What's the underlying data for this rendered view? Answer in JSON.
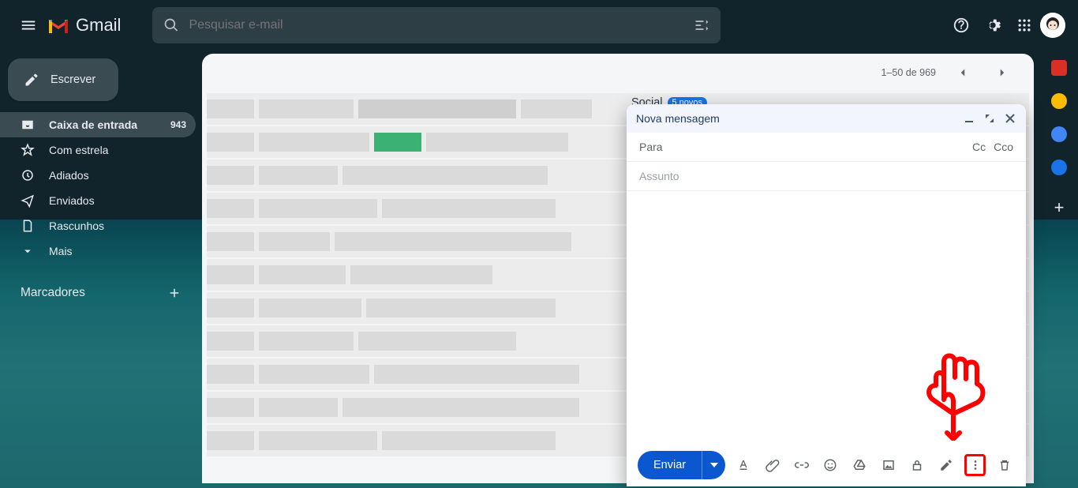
{
  "app": {
    "name": "Gmail"
  },
  "header": {
    "search_placeholder": "Pesquisar e-mail"
  },
  "compose_button": {
    "label": "Escrever"
  },
  "sidebar": {
    "items": [
      {
        "icon": "inbox",
        "label": "Caixa de entrada",
        "count": "943",
        "active": true
      },
      {
        "icon": "star",
        "label": "Com estrela"
      },
      {
        "icon": "clock",
        "label": "Adiados"
      },
      {
        "icon": "send",
        "label": "Enviados"
      },
      {
        "icon": "draft",
        "label": "Rascunhos"
      },
      {
        "icon": "more",
        "label": "Mais"
      }
    ],
    "labels_header": "Marcadores"
  },
  "list": {
    "range_text": "1–50 de 969",
    "social_tab": {
      "label": "Social",
      "badge": "5 novos"
    }
  },
  "compose_window": {
    "title": "Nova mensagem",
    "to_label": "Para",
    "cc_label": "Cc",
    "bcc_label": "Cco",
    "subject_placeholder": "Assunto",
    "send_label": "Enviar"
  }
}
